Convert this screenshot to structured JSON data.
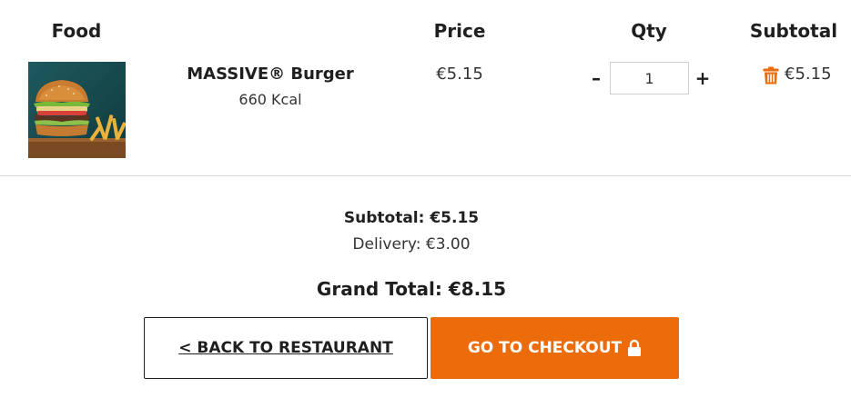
{
  "table": {
    "headers": {
      "food": "Food",
      "price": "Price",
      "qty": "Qty",
      "subtotal": "Subtotal"
    }
  },
  "items": [
    {
      "name": "MASSIVE® Burger",
      "kcal": "660 Kcal",
      "price": "€5.15",
      "quantity": "1",
      "subtotal": "€5.15",
      "image": "burger-and-fries-photo"
    }
  ],
  "controls": {
    "decrement_symbol": "–",
    "increment_symbol": "+",
    "remove_icon": "trash-icon"
  },
  "summary": {
    "subtotal": "Subtotal: €5.15",
    "delivery": "Delivery: €3.00",
    "grand_total": "Grand Total: €8.15"
  },
  "actions": {
    "back_label": "< BACK TO RESTAURANT",
    "checkout_label": "GO TO CHECKOUT",
    "checkout_icon": "lock-icon"
  },
  "colors": {
    "accent": "#ec6b0b",
    "text": "#1f1f1f",
    "divider": "#d6d6d6"
  }
}
